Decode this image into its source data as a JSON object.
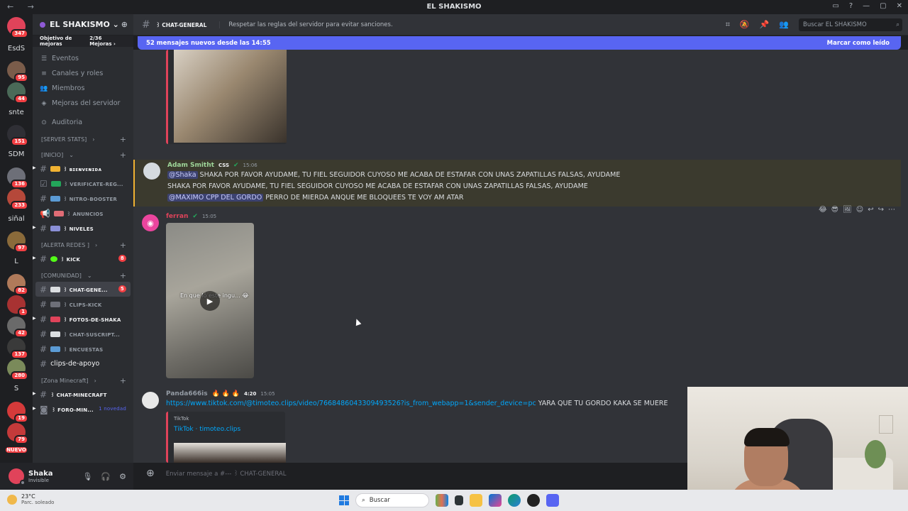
{
  "window": {
    "title": "EL SHAKISMO",
    "nav": "← →",
    "controls": [
      "▭",
      "?",
      "—",
      "▢",
      "✕"
    ]
  },
  "guilds": [
    {
      "label": "",
      "badge": "347",
      "color": "#e0435a"
    },
    {
      "label": "EsdS",
      "badge": ""
    },
    {
      "label": "",
      "badge": "95",
      "color": "#7a5c4a"
    },
    {
      "label": "",
      "badge": "44",
      "color": "#4a6a58"
    },
    {
      "label": "snte",
      "badge": ""
    },
    {
      "label": "",
      "badge": "151",
      "color": "#2f2f35"
    },
    {
      "label": "SDM",
      "badge": ""
    },
    {
      "label": "",
      "badge": "136",
      "color": "#6d6f78"
    },
    {
      "label": "",
      "badge": "233",
      "color": "#b5483a"
    },
    {
      "label": "siñal",
      "badge": ""
    },
    {
      "label": "",
      "badge": "97",
      "color": "#8a6a3a"
    },
    {
      "label": "L",
      "badge": ""
    },
    {
      "label": "",
      "badge": "82",
      "color": "#b07a5a"
    },
    {
      "label": "",
      "badge": "1",
      "color": "#a83232"
    },
    {
      "label": "",
      "badge": "42",
      "color": "#6a6a6a"
    },
    {
      "label": "",
      "badge": "137",
      "color": "#3a3a3a"
    },
    {
      "label": "",
      "badge": "280",
      "color": "#7a8a5a"
    },
    {
      "label": "S",
      "badge": ""
    },
    {
      "label": "",
      "badge": "19",
      "color": "#d43a3a"
    },
    {
      "label": "",
      "badge": "79",
      "color": "#c43a3a"
    },
    {
      "label": "NUEVO",
      "badge": ""
    }
  ],
  "server": {
    "name": "EL SHAKISMO ⌄",
    "boost_label": "Objetivo de mejoras",
    "boost_count": "2/36 Mejoras ›",
    "menu": [
      {
        "icon": "☰",
        "label": "Eventos"
      },
      {
        "icon": "≡",
        "label": "Canales y roles"
      },
      {
        "icon": "👥",
        "label": "Miembros"
      },
      {
        "icon": "◈",
        "label": "Mejoras del servidor"
      },
      {
        "icon": "⊙",
        "label": "Auditoria"
      }
    ],
    "categories": {
      "stats": "[SERVER STATS]",
      "inicio": "[INICIO]",
      "alerta": "[ALERTA REDES ]",
      "comunidad": "[COMUNIDAD]",
      "minecraft": "[Zona Minecraft]"
    },
    "channels": {
      "bienvenida": "꒱ ʙɪᴇɴᴠᴇɴɪᴅᴀ",
      "verificate": "꒱ VERIFICATE-REG...",
      "nitro": "꒱ NITRO-BOOSTER",
      "anuncios": "꒱ ANUNCIOS",
      "niveles": "꒱ NIVELES",
      "kick": "꒱ KICK",
      "kick_badge": "8",
      "chatgeneral": "꒱ CHAT-GENE...",
      "chatgeneral_badge": "5",
      "clipskick": "꒱ CLIPS-KICK",
      "fotos": "꒱ FOTOS-DE-SHAKA",
      "chatsuscript": "꒱ CHAT-SUSCRIPT...",
      "encuestas": "꒱ ENCUESTAS",
      "clips": "clips-de-apoyo",
      "chatminecraft": "꒱ CHAT-MINECRAFT",
      "foro": "꒱ FORO-MIN...",
      "foro_tag": "1 novedad"
    }
  },
  "user": {
    "name": "Shaka",
    "status": "Invisible"
  },
  "channel_header": {
    "name": "꒱ CHAT-GENERAL",
    "topic": "Respetar las reglas del servidor para evitar sanciones.",
    "search_placeholder": "Buscar EL SHAKISMO"
  },
  "new_messages": {
    "text": "52 mensajes nuevos desde las 14:55",
    "action": "Marcar como leído"
  },
  "messages": {
    "adam": {
      "author": "Adam Smitht",
      "tag": "CSS",
      "time": "15:06",
      "mention1": "@Shaka",
      "line1": " SHAKA POR FAVOR AYUDAME, TU FIEL SEGUIDOR CUYOSO ME ACABA DE ESTAFAR CON UNAS ZAPATILLAS FALSAS, AYUDAME",
      "line2": "SHAKA POR FAVOR AYUDAME, TU FIEL SEGUIDOR CUYOSO ME ACABA DE ESTAFAR CON UNAS ZAPATILLAS FALSAS, AYUDAME",
      "mention2": "@MAXIMO CPP DEL GORDO",
      "line3": " PERRO DE MIERDA ANQUE ME BLOQUEES TE VOY AM ATAR"
    },
    "ferran": {
      "author": "ferran",
      "time": "15:05",
      "video_caption": "En que   ló este ingu...  😂"
    },
    "panda": {
      "author": "Panda666is",
      "badges": "🔥 🔥 🔥",
      "tag": "4:20",
      "time": "15:05",
      "link": "https://www.tiktok.com/@timoteo.clips/video/7668486043309493526?is_from_webapp=1&sender_device=pc",
      "text": " YARA QUE TU GORDO KAKA SE MUERE",
      "embed_provider": "TikTok",
      "embed_title": "TikTok · timoteo.clips"
    }
  },
  "composer": {
    "placeholder": "Enviar mensaje a #--- ꒱ CHAT-GENERAL"
  },
  "taskbar": {
    "temp": "23°C",
    "weather": "Parc. soleado",
    "search": "Buscar"
  }
}
